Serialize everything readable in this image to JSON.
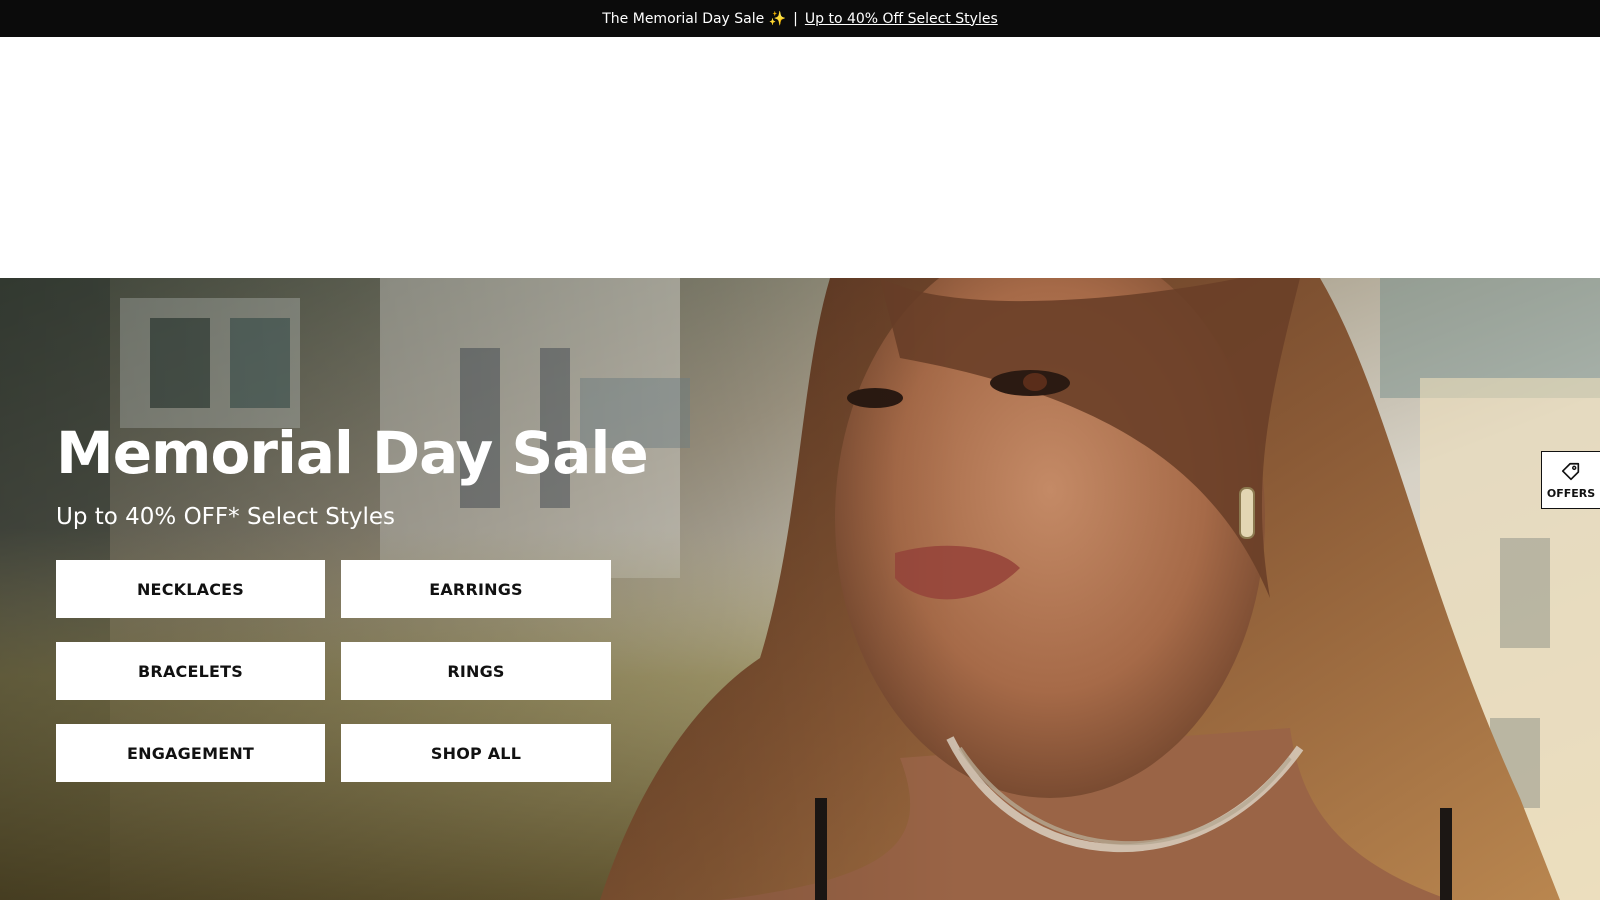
{
  "announcement": {
    "text": "The Memorial Day Sale ✨",
    "separator": "|",
    "link": "Up to 40% Off Select Styles"
  },
  "hero": {
    "title": "Memorial Day Sale",
    "subtitle": "Up to 40% OFF* Select Styles",
    "categories": [
      {
        "label": "NECKLACES"
      },
      {
        "label": "EARRINGS"
      },
      {
        "label": "BRACELETS"
      },
      {
        "label": "RINGS"
      },
      {
        "label": "ENGAGEMENT"
      },
      {
        "label": "SHOP ALL"
      }
    ]
  },
  "offers_tab": {
    "label": "OFFERS",
    "icon": "tag-icon"
  },
  "colors": {
    "announcement_bg": "#0b0b0b",
    "button_bg": "#ffffff",
    "button_text": "#111111"
  }
}
